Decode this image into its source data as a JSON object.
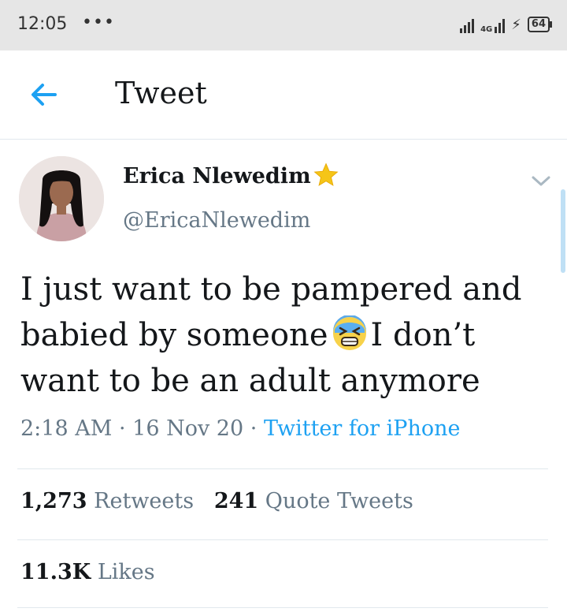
{
  "status_bar": {
    "time": "12:05",
    "dots": "•••",
    "network": "4G",
    "battery": "64"
  },
  "header": {
    "title": "Tweet"
  },
  "tweet": {
    "author_name": "Erica Nlewedim",
    "handle": "@EricaNlewedim",
    "text_line1": "I just want to be pampered and",
    "text_line2a": "babied by someone",
    "text_line2b": "I don’t",
    "text_line3": "want to be an adult anymore",
    "time": "2:18 AM",
    "date": "16 Nov 20",
    "separator": "·",
    "source": "Twitter for iPhone"
  },
  "stats": {
    "retweets_count": "1,273",
    "retweets_label": "Retweets",
    "quotes_count": "241",
    "quotes_label": "Quote Tweets",
    "likes_count": "11.3K",
    "likes_label": "Likes"
  },
  "colors": {
    "accent": "#1da1f2",
    "secondary_text": "#657786",
    "primary_text": "#14171a",
    "star": "#f5c518"
  }
}
